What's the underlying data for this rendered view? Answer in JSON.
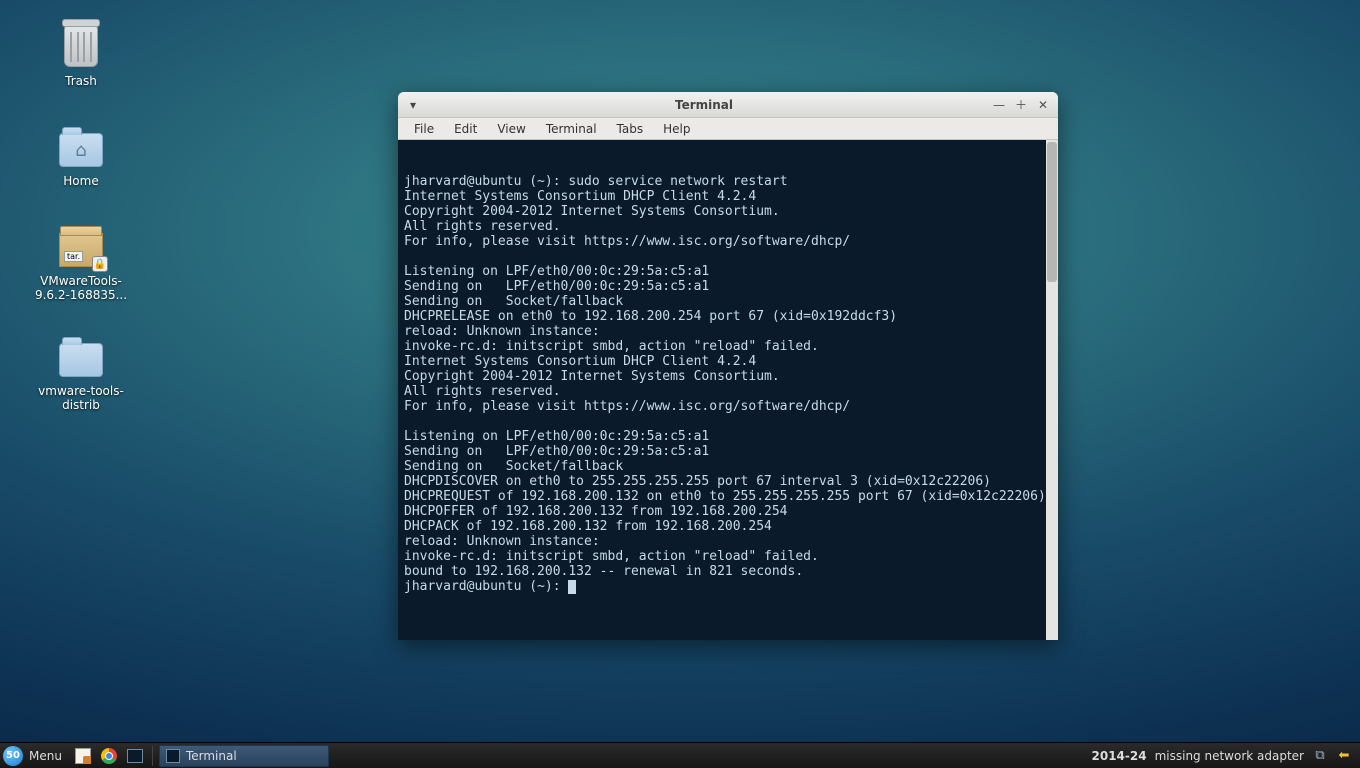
{
  "desktop_icons": [
    {
      "name": "trash",
      "label": "Trash"
    },
    {
      "name": "home",
      "label": "Home"
    },
    {
      "name": "vmwaretools-pkg",
      "label": "VMwareTools-9.6.2-168835..."
    },
    {
      "name": "vmwaretools-dir",
      "label": "vmware-tools-distrib"
    }
  ],
  "window": {
    "title": "Terminal",
    "menus": [
      "File",
      "Edit",
      "View",
      "Terminal",
      "Tabs",
      "Help"
    ],
    "prompt": "jharvard@ubuntu (~): ",
    "first_command": "sudo service network restart",
    "body_lines": [
      "Internet Systems Consortium DHCP Client 4.2.4",
      "Copyright 2004-2012 Internet Systems Consortium.",
      "All rights reserved.",
      "For info, please visit https://www.isc.org/software/dhcp/",
      "",
      "Listening on LPF/eth0/00:0c:29:5a:c5:a1",
      "Sending on   LPF/eth0/00:0c:29:5a:c5:a1",
      "Sending on   Socket/fallback",
      "DHCPRELEASE on eth0 to 192.168.200.254 port 67 (xid=0x192ddcf3)",
      "reload: Unknown instance:",
      "invoke-rc.d: initscript smbd, action \"reload\" failed.",
      "Internet Systems Consortium DHCP Client 4.2.4",
      "Copyright 2004-2012 Internet Systems Consortium.",
      "All rights reserved.",
      "For info, please visit https://www.isc.org/software/dhcp/",
      "",
      "Listening on LPF/eth0/00:0c:29:5a:c5:a1",
      "Sending on   LPF/eth0/00:0c:29:5a:c5:a1",
      "Sending on   Socket/fallback",
      "DHCPDISCOVER on eth0 to 255.255.255.255 port 67 interval 3 (xid=0x12c22206)",
      "DHCPREQUEST of 192.168.200.132 on eth0 to 255.255.255.255 port 67 (xid=0x12c22206)",
      "DHCPOFFER of 192.168.200.132 from 192.168.200.254",
      "DHCPACK of 192.168.200.132 from 192.168.200.254",
      "reload: Unknown instance:",
      "invoke-rc.d: initscript smbd, action \"reload\" failed.",
      "bound to 192.168.200.132 -- renewal in 821 seconds."
    ]
  },
  "taskbar": {
    "badge": "50",
    "menu_label": "Menu",
    "active_task": "Terminal",
    "clock": "2014-24",
    "status_text": "missing network adapter"
  }
}
